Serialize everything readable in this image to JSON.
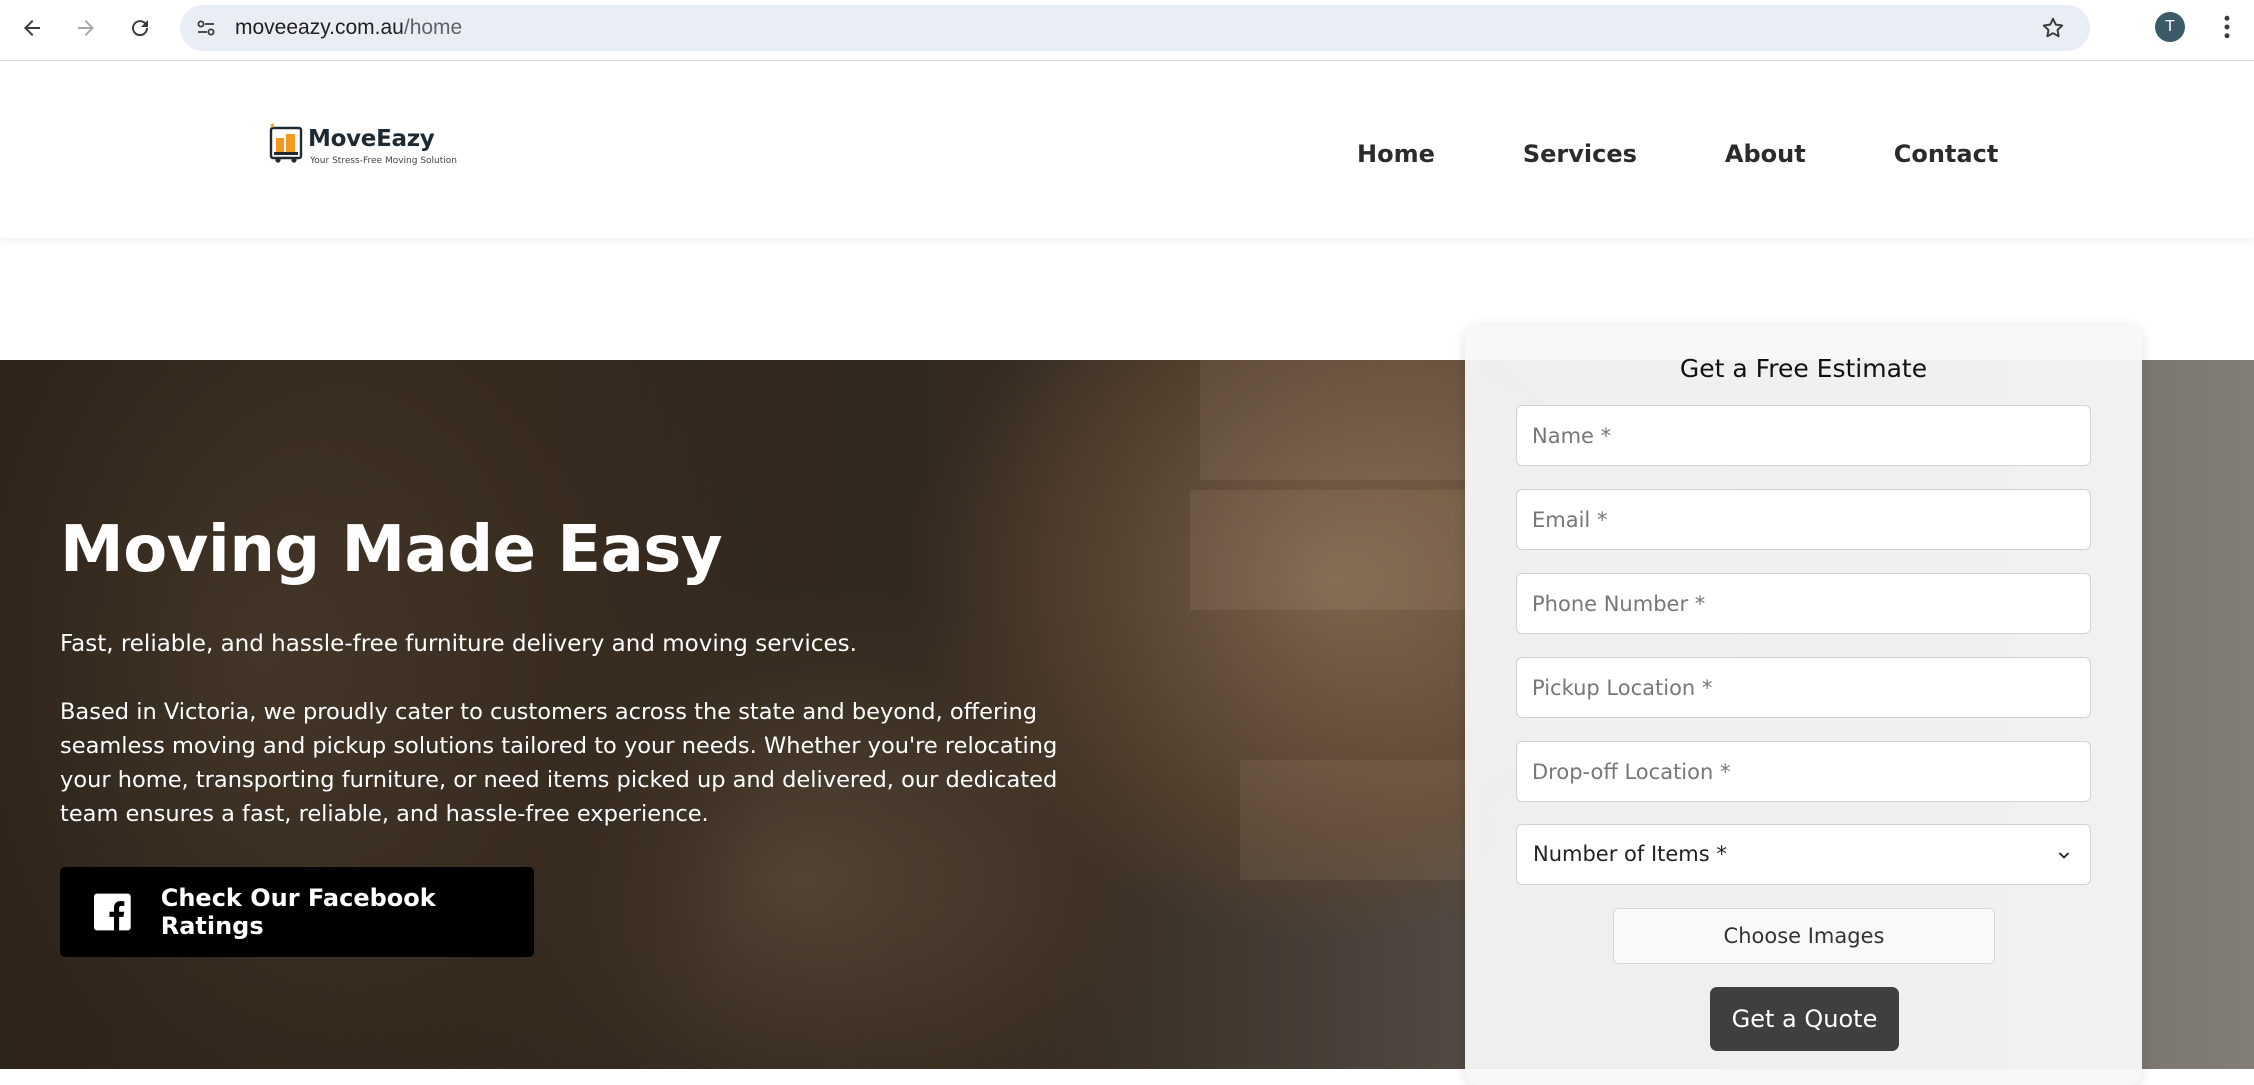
{
  "browser": {
    "url_host": "moveeazy.com.au",
    "url_path": "/home",
    "profile_initial": "T",
    "icons": [
      "back-arrow-icon",
      "forward-arrow-icon",
      "reload-icon",
      "site-info-icon",
      "bookmark-star-icon",
      "kebab-menu-icon"
    ]
  },
  "site": {
    "logo_name": "MoveEazy",
    "logo_tagline": "Your Stress-Free Moving Solution",
    "nav": [
      "Home",
      "Services",
      "About",
      "Contact"
    ]
  },
  "hero": {
    "title": "Moving Made Easy",
    "subtitle": "Fast, reliable, and hassle-free furniture delivery and moving services.",
    "body": "Based in Victoria, we proudly cater to customers across the state and beyond, offering seamless moving and pickup solutions tailored to your needs. Whether you're relocating your home, transporting furniture, or need items picked up and delivered, our dedicated team ensures a fast, reliable, and hassle-free experience.",
    "facebook_button": "Check Our Facebook Ratings"
  },
  "estimate_form": {
    "title": "Get a Free Estimate",
    "name_placeholder": "Name *",
    "email_placeholder": "Email *",
    "phone_placeholder": "Phone Number *",
    "pickup_placeholder": "Pickup Location *",
    "dropoff_placeholder": "Drop-off Location *",
    "items_select": "Number of Items *",
    "choose_images": "Choose Images",
    "submit": "Get a Quote"
  },
  "colors": {
    "button_dark": "#000000",
    "quote_button": "#3f3f3f",
    "omnibox": "#e9eef6"
  }
}
